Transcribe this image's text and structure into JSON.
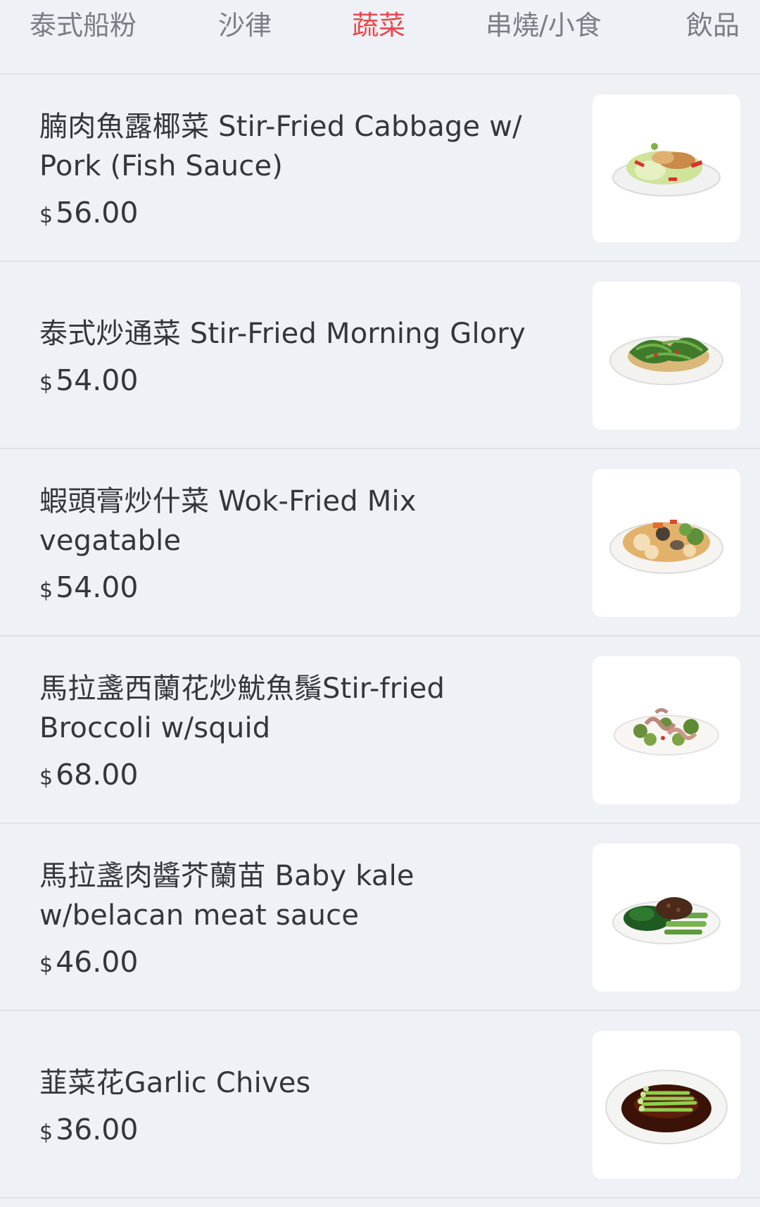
{
  "tabs": [
    {
      "label": "泰式船粉",
      "active": false
    },
    {
      "label": "沙律",
      "active": false
    },
    {
      "label": "蔬菜",
      "active": true
    },
    {
      "label": "串燒/小食",
      "active": false
    },
    {
      "label": "飲品",
      "active": false
    }
  ],
  "active_color": "#e8484c",
  "items": [
    {
      "name": "腩肉魚露椰菜 Stir-Fried Cabbage w/ Pork (Fish Sauce)",
      "currency": "$",
      "price": "56.00",
      "image_icon": "stir-fried-cabbage-dish-photo"
    },
    {
      "name": "泰式炒通菜 Stir-Fried Morning Glory",
      "currency": "$",
      "price": "54.00",
      "image_icon": "morning-glory-dish-photo"
    },
    {
      "name": "蝦頭膏炒什菜 Wok-Fried Mix vegatable",
      "currency": "$",
      "price": "54.00",
      "image_icon": "mixed-vegetable-dish-photo"
    },
    {
      "name": "馬拉盞西蘭花炒魷魚鬚Stir-fried Broccoli w/squid",
      "currency": "$",
      "price": "68.00",
      "image_icon": "broccoli-squid-dish-photo"
    },
    {
      "name": "馬拉盞肉醬芥蘭苗 Baby kale w/belacan meat sauce",
      "currency": "$",
      "price": "46.00",
      "image_icon": "baby-kale-dish-photo"
    },
    {
      "name": "韮菜花Garlic Chives",
      "currency": "$",
      "price": "36.00",
      "image_icon": "garlic-chives-dish-photo"
    }
  ]
}
